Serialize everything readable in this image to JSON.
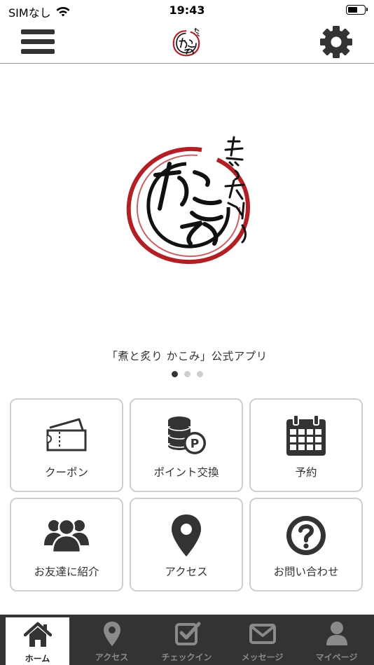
{
  "status_bar": {
    "carrier": "SIMなし",
    "time": "19:43",
    "battery_level": 0.6
  },
  "header": {
    "menu_icon": "hamburger-menu-icon",
    "settings_icon": "gear-icon"
  },
  "logo": {
    "name": "煮と炙り かこみ",
    "accent_color": "#b21f24"
  },
  "hero": {
    "caption": "「煮と炙り かこみ」公式アプリ",
    "slide_count": 3,
    "active_slide": 1
  },
  "menu_tiles": [
    {
      "label": "クーポン",
      "icon": "ticket-icon"
    },
    {
      "label": "ポイント交換",
      "icon": "coins-point-icon"
    },
    {
      "label": "予約",
      "icon": "calendar-icon"
    },
    {
      "label": "お友達に紹介",
      "icon": "users-group-icon"
    },
    {
      "label": "アクセス",
      "icon": "map-pin-icon"
    },
    {
      "label": "お問い合わせ",
      "icon": "question-circle-icon"
    }
  ],
  "tab_bar": {
    "tabs": [
      {
        "label": "ホーム",
        "icon": "home-icon",
        "active": true
      },
      {
        "label": "アクセス",
        "icon": "map-pin-icon",
        "active": false
      },
      {
        "label": "チェックイン",
        "icon": "checkbox-icon",
        "active": false
      },
      {
        "label": "メッセージ",
        "icon": "envelope-icon",
        "active": false
      },
      {
        "label": "マイページ",
        "icon": "user-icon",
        "active": false
      }
    ]
  },
  "colors": {
    "primary_dark": "#333333",
    "tab_inactive": "#8a8a8a",
    "tile_border": "#cfcfcf"
  }
}
